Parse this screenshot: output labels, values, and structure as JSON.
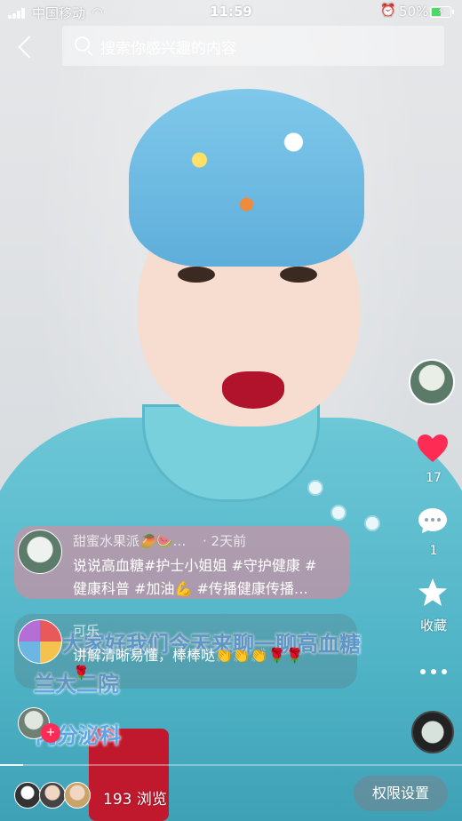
{
  "status_bar": {
    "carrier": "中国移动",
    "time": "11:59",
    "battery": "50%",
    "battery_level": 0.5
  },
  "search": {
    "placeholder": "搜索你感兴趣的内容"
  },
  "video_captions": [
    "大家好我们今天来聊一聊高血糖",
    "兰大二院",
    "内分泌科"
  ],
  "right_rail": {
    "likes": "17",
    "comments": "1",
    "favorite_label": "收藏"
  },
  "comments": [
    {
      "user": "甜蜜水果派🥭🍉…",
      "time": "· 2天前",
      "line1": "说说高血糖#护士小姐姐 #守护健康 #",
      "line2": "健康科普 #加油💪 #传播健康传播…"
    },
    {
      "user": "可乐",
      "text": "讲解清晰易懂，棒棒哒👏👏👏🌹🌹",
      "extra": "🌹"
    }
  ],
  "follow": {
    "plus": "+"
  },
  "progress": 0.05,
  "bottom": {
    "views": "193 浏览",
    "permission_button": "权限设置"
  },
  "colors": {
    "like": "#fe2c55",
    "caption": "#5ca5e6"
  }
}
